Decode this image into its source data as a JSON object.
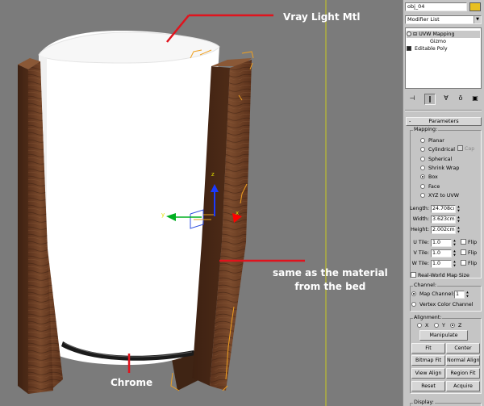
{
  "annotations": {
    "vray": "Vray Light Mtl",
    "bed_line1": "same as the material",
    "bed_line2": "from the bed",
    "chrome": "Chrome"
  },
  "panel": {
    "object_name": "obj_04",
    "object_color": "#e8c020",
    "modifier_list": "Modifier List",
    "stack": [
      {
        "label": "UVW Mapping",
        "expand": "⊟"
      },
      {
        "label": "Gizmo"
      },
      {
        "label": "Editable Poly",
        "expand": "⊞"
      }
    ],
    "tool_icons": [
      "pin-icon",
      "show-end-result-icon",
      "make-unique-icon",
      "remove-modifier-icon",
      "configure-icon"
    ],
    "rollout_title": "Parameters",
    "rollout_toggle": "-",
    "mapping": {
      "title": "Mapping:",
      "options": [
        {
          "label": "Planar",
          "selected": false
        },
        {
          "label": "Cylindrical",
          "selected": false
        },
        {
          "label": "Spherical",
          "selected": false
        },
        {
          "label": "Shrink Wrap",
          "selected": false
        },
        {
          "label": "Box",
          "selected": true
        },
        {
          "label": "Face",
          "selected": false
        },
        {
          "label": "XYZ to UVW",
          "selected": false
        }
      ],
      "cap_label": "Cap",
      "length_label": "Length:",
      "length_value": "24.708cı",
      "width_label": "Width:",
      "width_value": "3.623cm",
      "height_label": "Height:",
      "height_value": "2.002cm",
      "u_tile_label": "U Tile:",
      "u_tile_value": "1.0",
      "v_tile_label": "V Tile:",
      "v_tile_value": "1.0",
      "w_tile_label": "W Tile:",
      "w_tile_value": "1.0",
      "flip_label": "Flip",
      "real_world_label": "Real-World Map Size"
    },
    "channel": {
      "title": "Channel:",
      "map_channel_label": "Map Channel:",
      "map_channel_value": "1",
      "vertex_color_label": "Vertex Color Channel"
    },
    "alignment": {
      "title": "Alignment:",
      "axes": [
        {
          "label": "X",
          "selected": false
        },
        {
          "label": "Y",
          "selected": false
        },
        {
          "label": "Z",
          "selected": true
        }
      ],
      "manipulate": "Manipulate",
      "fit": "Fit",
      "center": "Center",
      "bitmap_fit": "Bitmap Fit",
      "normal_align": "Normal Align",
      "view_align": "View Align",
      "region_fit": "Region Fit",
      "reset": "Reset",
      "acquire": "Acquire"
    },
    "display_title": "Display:"
  },
  "colors": {
    "viewport_bg": "#7b7b7b",
    "annotation_line": "#e0131d",
    "wood": "#6b3d22",
    "selection": "#f0a020",
    "grid_line": "#c8c820"
  }
}
